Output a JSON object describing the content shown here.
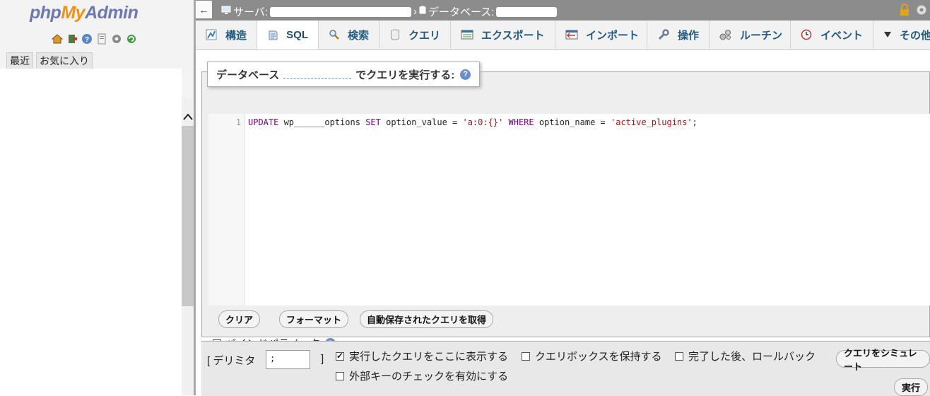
{
  "nav": {
    "logo_php": "php",
    "logo_my": "My",
    "logo_admin": "Admin",
    "icons": [
      "home-icon",
      "logout-icon",
      "help-icon",
      "docs-icon",
      "settings-icon",
      "reload-icon"
    ],
    "tabs": [
      "最近",
      "お気に入り"
    ]
  },
  "breadcrumb": {
    "server_label": "サーバ:",
    "database_label": "データベース:"
  },
  "tabs": [
    {
      "label": "構造",
      "icon": "structure-icon"
    },
    {
      "label": "SQL",
      "icon": "sql-icon",
      "active": true
    },
    {
      "label": "検索",
      "icon": "search-icon"
    },
    {
      "label": "クエリ",
      "icon": "query-icon"
    },
    {
      "label": "エクスポート",
      "icon": "export-icon"
    },
    {
      "label": "インポート",
      "icon": "import-icon"
    },
    {
      "label": "操作",
      "icon": "wrench-icon"
    },
    {
      "label": "ルーチン",
      "icon": "routines-icon"
    },
    {
      "label": "イベント",
      "icon": "events-icon"
    },
    {
      "label": "その他",
      "icon": "chevron-down-icon"
    }
  ],
  "sql": {
    "legend_prefix": "データベース",
    "legend_suffix": "でクエリを実行する:",
    "line_number": "1",
    "code": {
      "kw_update": "UPDATE",
      "table": " wp______options ",
      "kw_set": "SET",
      "col1": " option_value = ",
      "val1": "'a:0:{}'",
      "kw_where": " WHERE",
      "col2": " option_name = ",
      "val2": "'active_plugins'",
      "end": ";"
    },
    "buttons": {
      "clear": "クリア",
      "format": "フォーマット",
      "autosave": "自動保存されたクエリを取得"
    },
    "bind_params": "バインドパラメータ"
  },
  "options": {
    "delimiter_open": "[ デリミタ",
    "delimiter_value": ";",
    "delimiter_close": "]",
    "show_query": {
      "label": "実行したクエリをここに表示する",
      "checked": true
    },
    "retain_box": {
      "label": "クエリボックスを保持する",
      "checked": false
    },
    "rollback": {
      "label": "完了した後、ロールバック",
      "checked": false
    },
    "foreign_keys": {
      "label": "外部キーのチェックを有効にする",
      "checked": false
    },
    "simulate": "クエリをシミュレート",
    "go": "実行"
  }
}
